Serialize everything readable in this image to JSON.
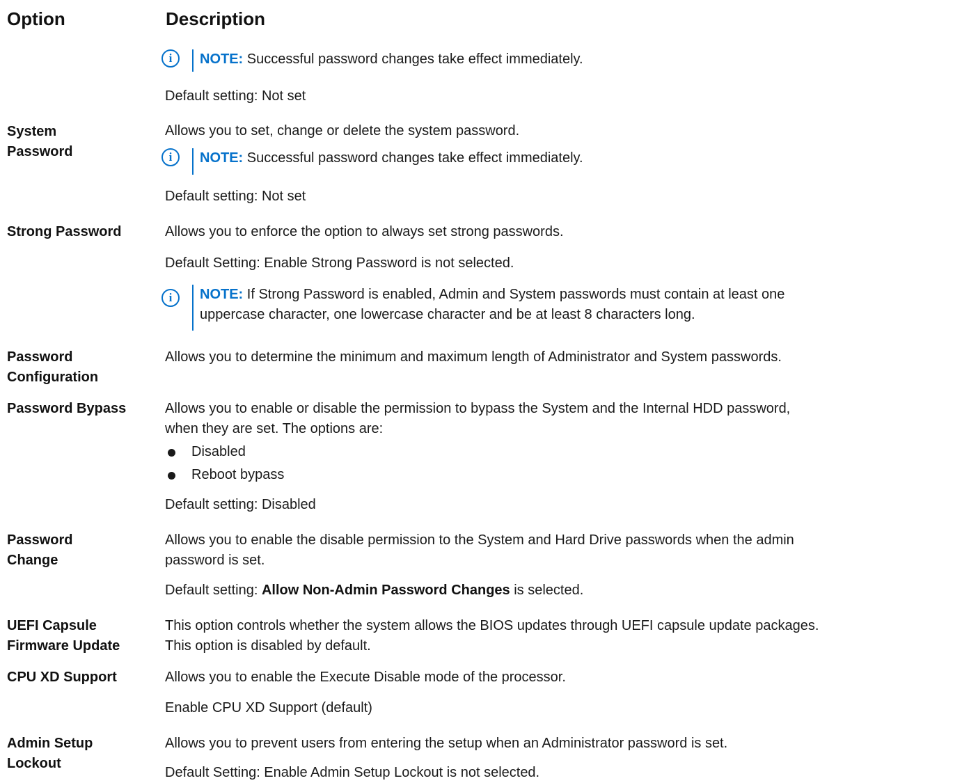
{
  "header": {
    "option": "Option",
    "description": "Description"
  },
  "note_icon": "info-circle-icon",
  "accent_color": "#0672cb",
  "rows": {
    "admin_password": {
      "note": {
        "tag": "NOTE:",
        "text": "Successful password changes take effect immediately."
      },
      "default": "Default setting: Not set"
    },
    "system_password": {
      "label": [
        "System",
        "Password"
      ],
      "desc": "Allows you to set, change or delete the system password.",
      "note": {
        "tag": "NOTE:",
        "text": "Successful password changes take effect immediately."
      },
      "default": "Default setting: Not set"
    },
    "strong_password": {
      "label": [
        "Strong Password"
      ],
      "desc": "Allows you to enforce the option to always set strong passwords.",
      "default": "Default Setting: Enable Strong Password is not selected.",
      "note": {
        "tag": "NOTE:",
        "text1": "If Strong Password is enabled, Admin and System passwords must contain at least one",
        "text2": "uppercase character, one lowercase character and be at least 8 characters long."
      }
    },
    "password_configuration": {
      "label": [
        "Password",
        "Configuration"
      ],
      "desc": "Allows you to determine the minimum and maximum length of Administrator and System passwords."
    },
    "password_bypass": {
      "label": [
        "Password Bypass"
      ],
      "desc1": "Allows you to enable or disable the permission to bypass the System and the Internal HDD password,",
      "desc2": "when they are set. The options are:",
      "options": [
        "Disabled",
        "Reboot bypass"
      ],
      "default": "Default setting: Disabled"
    },
    "password_change": {
      "label": [
        "Password",
        "Change"
      ],
      "desc1": "Allows you to enable the disable permission to the System and Hard Drive passwords when the admin",
      "desc2": "password is set.",
      "default_prefix": "Default setting: ",
      "default_bold": "Allow Non-Admin Password Changes",
      "default_suffix": " is selected."
    },
    "uefi_capsule": {
      "label": [
        "UEFI Capsule",
        "Firmware Update"
      ],
      "desc1": "This option controls whether the system allows the BIOS updates through UEFI capsule update packages.",
      "desc2": "This option is disabled by default."
    },
    "cpu_xd": {
      "label": [
        "CPU XD Support"
      ],
      "desc": "Allows you to enable the Execute Disable mode of the processor.",
      "default": "Enable CPU XD Support (default)"
    },
    "admin_setup_lockout": {
      "label": [
        "Admin Setup",
        "Lockout"
      ],
      "desc": "Allows you to prevent users from entering the setup when an Administrator password is set.",
      "default": "Default Setting: Enable Admin Setup Lockout is not selected."
    }
  }
}
